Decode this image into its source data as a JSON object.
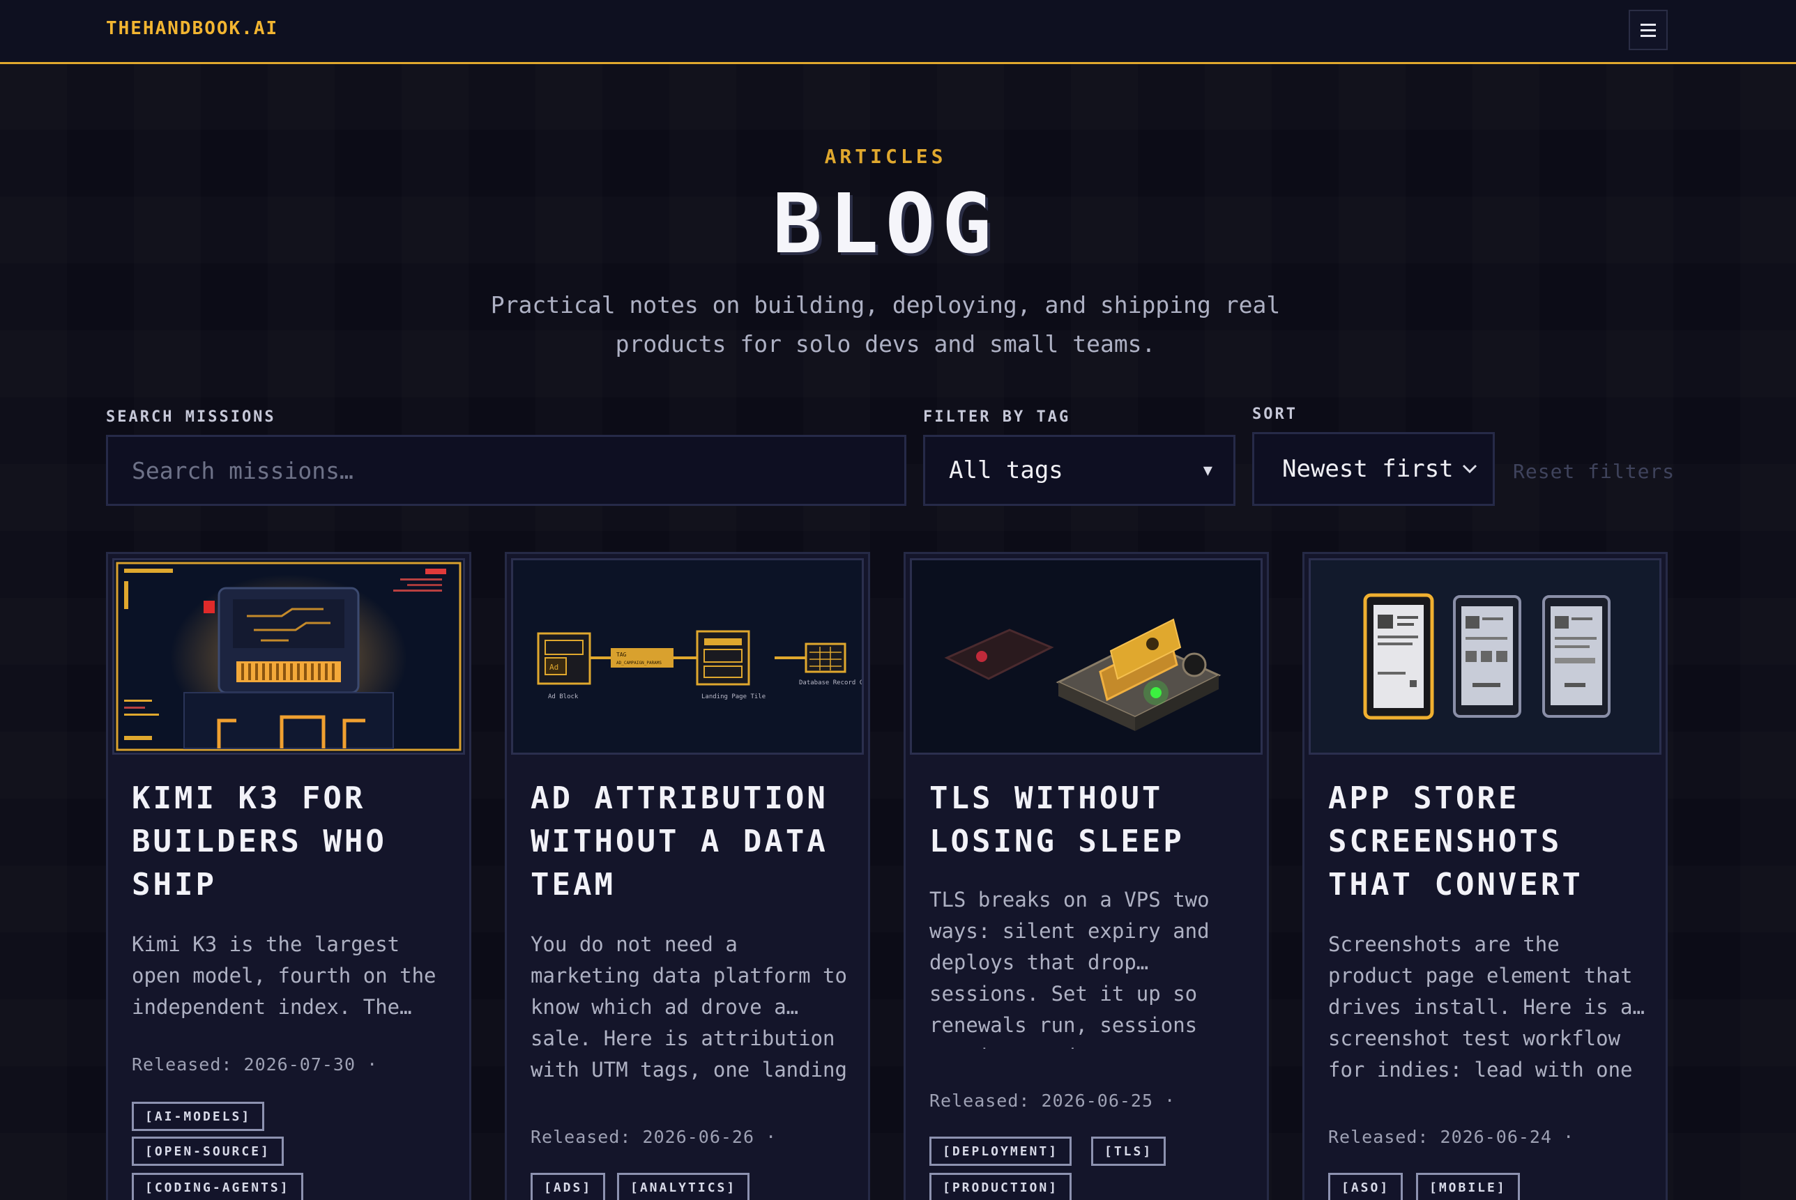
{
  "header": {
    "brand": "THEHANDBOOK.AI",
    "menu_icon": "hamburger-icon"
  },
  "hero": {
    "eyebrow": "ARTICLES",
    "title": "BLOG",
    "subtitle": "Practical notes on building, deploying, and shipping real products for solo devs and small teams."
  },
  "filters": {
    "search_label": "SEARCH MISSIONS",
    "search_placeholder": "Search missions…",
    "tag_label": "FILTER BY TAG",
    "tag_value": "All tags",
    "sort_label": "SORT",
    "sort_value": "Newest first",
    "reset_label": "Reset filters"
  },
  "colors": {
    "accent": "#e0a82e",
    "background": "#0c0c17",
    "card": "#14152a"
  },
  "cards": [
    {
      "title": "KIMI K3 FOR BUILDERS WHO SHIP",
      "excerpt": "Kimi K3 is the largest open model, fourth on the independent index. The…",
      "released": "Released: 2026-07-30 ·",
      "tags": [
        "[AI-MODELS]",
        "[OPEN-SOURCE]",
        "[CODING-AGENTS]"
      ]
    },
    {
      "title": "AD ATTRIBUTION WITHOUT A DATA TEAM",
      "excerpt": "You do not need a marketing data platform to know which ad drove a… sale. Here is attribution with UTM tags, one landing",
      "released": "Released: 2026-06-26 ·",
      "tags": [
        "[ADS]",
        "[ANALYTICS]"
      ],
      "thumb_labels": {
        "tag": "TAG",
        "tag_sub": "AD_CAMPAIGN_PARAMS",
        "ad": "Ad",
        "ad_block": "Ad Block",
        "landing": "Landing Page Tile",
        "database": "Database Record Card"
      }
    },
    {
      "title": "TLS WITHOUT LOSING SLEEP",
      "excerpt": "TLS breaks on a VPS two ways: silent expiry and deploys that drop… sessions. Set it up so renewals run, sessions survive, and you stop",
      "released": "Released: 2026-06-25 ·",
      "tags": [
        "[DEPLOYMENT]",
        "[TLS]",
        "[PRODUCTION]"
      ]
    },
    {
      "title": "APP STORE SCREENSHOTS THAT CONVERT",
      "excerpt": "Screenshots are the product page element that drives install. Here is a… screenshot test workflow for indies: lead with one",
      "released": "Released: 2026-06-24 ·",
      "tags": [
        "[ASO]",
        "[MOBILE]"
      ]
    }
  ]
}
